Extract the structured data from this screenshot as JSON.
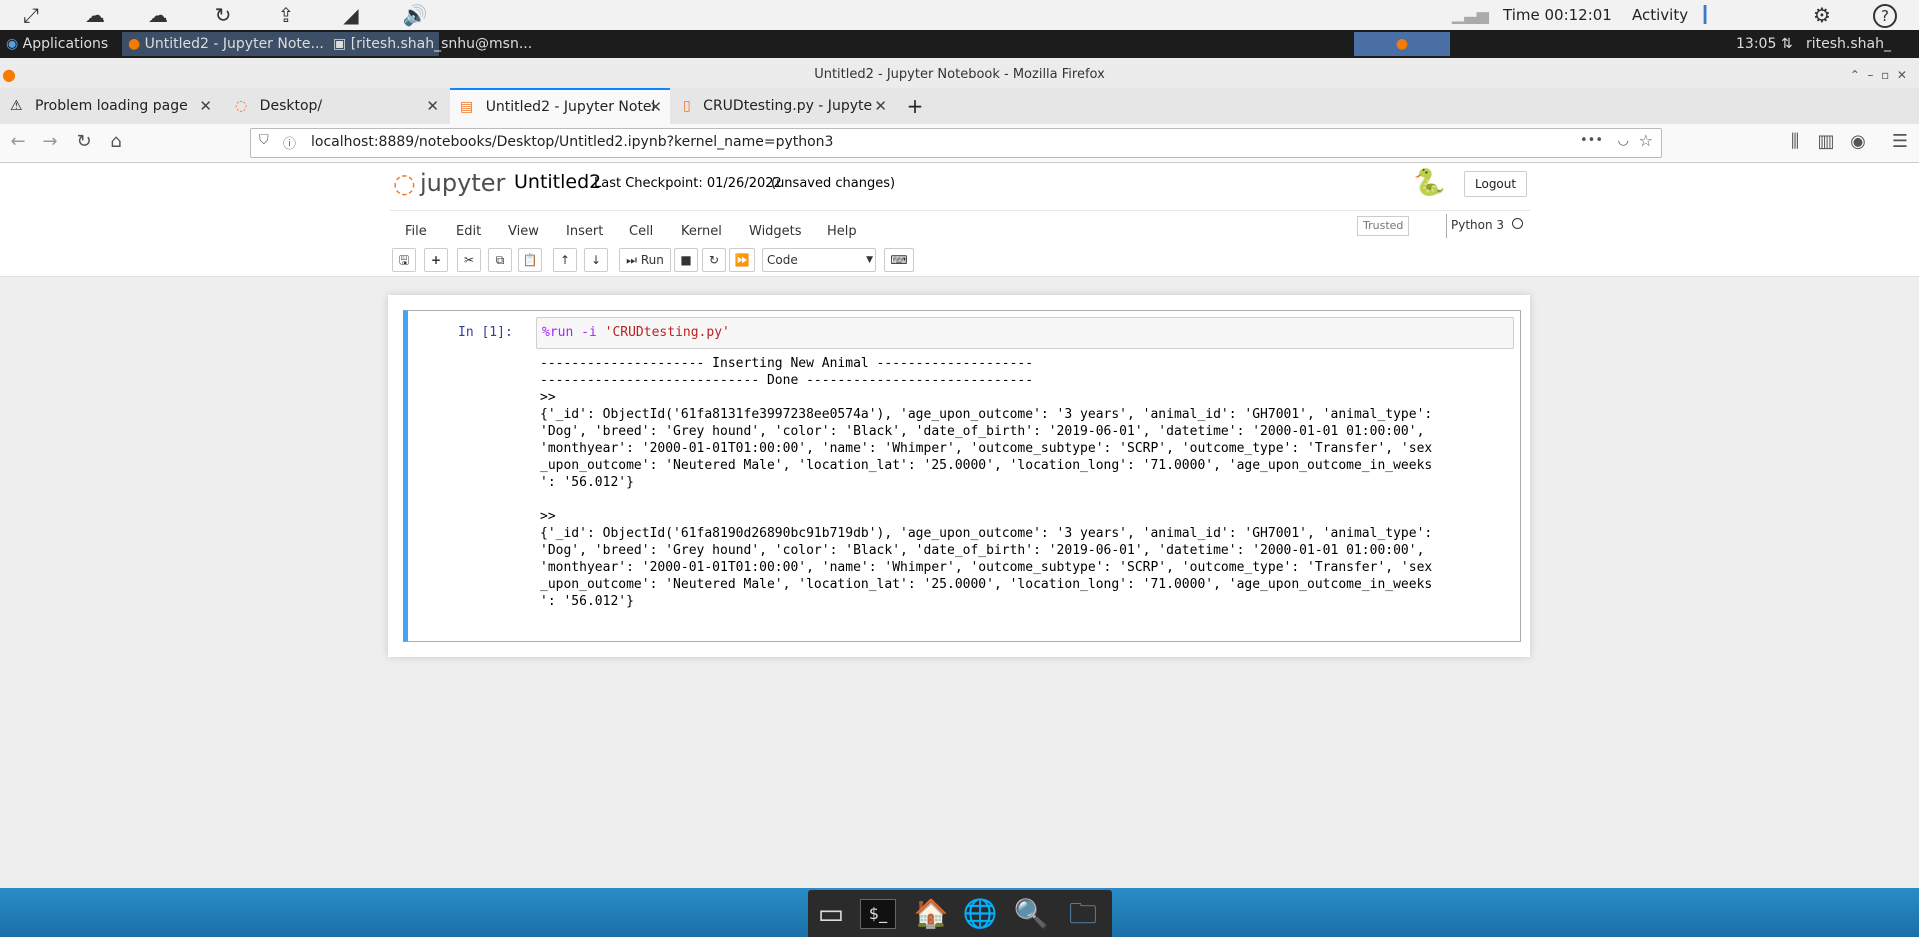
{
  "vnc": {
    "time": "Time 00:12:01",
    "activity": "Activity"
  },
  "panel": {
    "applications": "Applications",
    "window1": "Untitled2 - Jupyter Note...",
    "window2": "[ritesh.shah_snhu@msn...",
    "clock": "13:05",
    "user": "ritesh.shah_"
  },
  "firefox": {
    "title": "Untitled2 - Jupyter Notebook - Mozilla Firefox",
    "tabs": [
      {
        "label": "Problem loading page"
      },
      {
        "label": "Desktop/"
      },
      {
        "label": "Untitled2 - Jupyter Notel"
      },
      {
        "label": "CRUDtesting.py - Jupyte"
      }
    ],
    "url": "localhost:8889/notebooks/Desktop/Untitled2.ipynb?kernel_name=python3"
  },
  "jupyter": {
    "logo": "jupyter",
    "notebook_name": "Untitled2",
    "checkpoint": "Last Checkpoint: 01/26/2022",
    "unsaved": "(unsaved changes)",
    "logout": "Logout",
    "menu": [
      "File",
      "Edit",
      "View",
      "Insert",
      "Cell",
      "Kernel",
      "Widgets",
      "Help"
    ],
    "trusted": "Trusted",
    "kernel": "Python 3",
    "run_label": "Run",
    "cell_type": "Code"
  },
  "cell": {
    "prompt": "In [1]:",
    "code_magic": "%run -i ",
    "code_str": "'CRUDtesting.py'",
    "output": "--------------------- Inserting New Animal --------------------\n---------------------------- Done -----------------------------\n>>\n{'_id': ObjectId('61fa8131fe3997238ee0574a'), 'age_upon_outcome': '3 years', 'animal_id': 'GH7001', 'animal_type':\n'Dog', 'breed': 'Grey hound', 'color': 'Black', 'date_of_birth': '2019-06-01', 'datetime': '2000-01-01 01:00:00',\n'monthyear': '2000-01-01T01:00:00', 'name': 'Whimper', 'outcome_subtype': 'SCRP', 'outcome_type': 'Transfer', 'sex\n_upon_outcome': 'Neutered Male', 'location_lat': '25.0000', 'location_long': '71.0000', 'age_upon_outcome_in_weeks\n': '56.012'}\n\n>>\n{'_id': ObjectId('61fa8190d26890bc91b719db'), 'age_upon_outcome': '3 years', 'animal_id': 'GH7001', 'animal_type':\n'Dog', 'breed': 'Grey hound', 'color': 'Black', 'date_of_birth': '2019-06-01', 'datetime': '2000-01-01 01:00:00',\n'monthyear': '2000-01-01T01:00:00', 'name': 'Whimper', 'outcome_subtype': 'SCRP', 'outcome_type': 'Transfer', 'sex\n_upon_outcome': 'Neutered Male', 'location_lat': '25.0000', 'location_long': '71.0000', 'age_upon_outcome_in_weeks\n': '56.012'}"
  },
  "colors": {
    "cell_accent": "#42a5f5",
    "jupyter_orange": "#f37726",
    "firefox_accent": "#0a84ff"
  }
}
